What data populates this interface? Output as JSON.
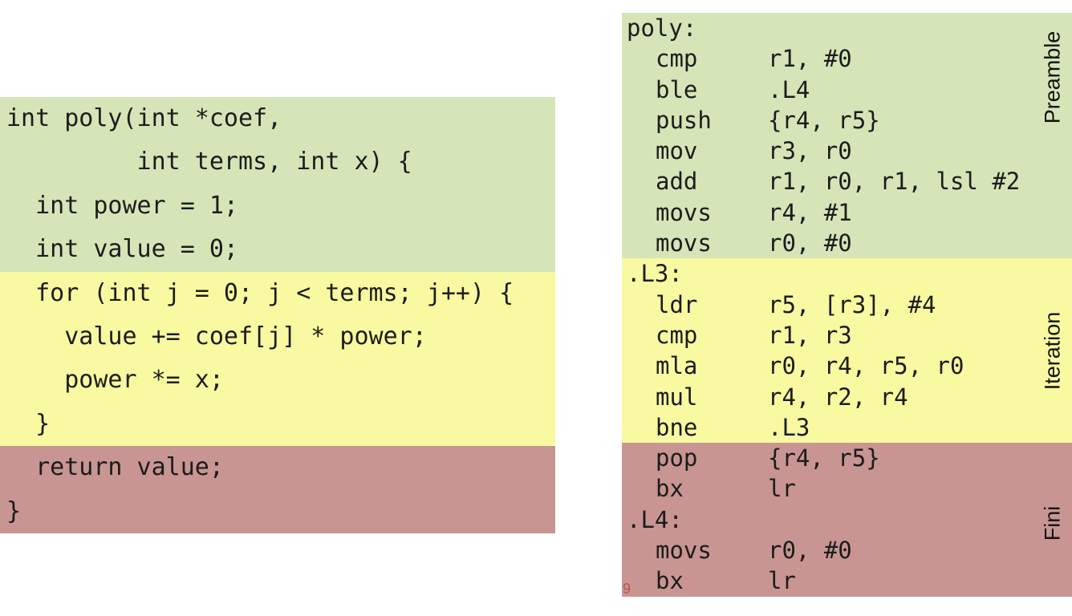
{
  "c_code": {
    "preamble": [
      "int poly(int *coef,",
      "         int terms, int x) {",
      "  int power = 1;",
      "  int value = 0;"
    ],
    "iteration": [
      "  for (int j = 0; j < terms; j++) {",
      "    value += coef[j] * power;",
      "    power *= x;",
      "  }"
    ],
    "fini": [
      "  return value;",
      "}"
    ]
  },
  "asm": {
    "preamble": {
      "label": "Preamble",
      "lines": [
        {
          "label": "poly:",
          "op": "",
          "args": ""
        },
        {
          "label": "",
          "op": "cmp",
          "args": "r1, #0"
        },
        {
          "label": "",
          "op": "ble",
          "args": ".L4"
        },
        {
          "label": "",
          "op": "push",
          "args": "{r4, r5}"
        },
        {
          "label": "",
          "op": "mov",
          "args": "r3, r0"
        },
        {
          "label": "",
          "op": "add",
          "args": "r1, r0, r1, lsl #2"
        },
        {
          "label": "",
          "op": "movs",
          "args": "r4, #1"
        },
        {
          "label": "",
          "op": "movs",
          "args": "r0, #0"
        }
      ]
    },
    "iteration": {
      "label": "Iteration",
      "lines": [
        {
          "label": ".L3:",
          "op": "",
          "args": ""
        },
        {
          "label": "",
          "op": "ldr",
          "args": "r5, [r3], #4"
        },
        {
          "label": "",
          "op": "cmp",
          "args": "r1, r3"
        },
        {
          "label": "",
          "op": "mla",
          "args": "r0, r4, r5, r0"
        },
        {
          "label": "",
          "op": "mul",
          "args": "r4, r2, r4"
        },
        {
          "label": "",
          "op": "bne",
          "args": ".L3"
        }
      ]
    },
    "fini": {
      "label": "Fini",
      "lines": [
        {
          "label": "",
          "op": "pop",
          "args": "{r4, r5}"
        },
        {
          "label": "",
          "op": "bx",
          "args": "lr"
        },
        {
          "label": ".L4:",
          "op": "",
          "args": ""
        },
        {
          "label": "",
          "op": "movs",
          "args": "r0, #0"
        },
        {
          "label": "",
          "op": "bx",
          "args": "lr"
        }
      ]
    }
  },
  "colors": {
    "preamble": "#d5e5b7",
    "iteration": "#f8f9a0",
    "fini": "#c89592"
  },
  "page_number": "9"
}
